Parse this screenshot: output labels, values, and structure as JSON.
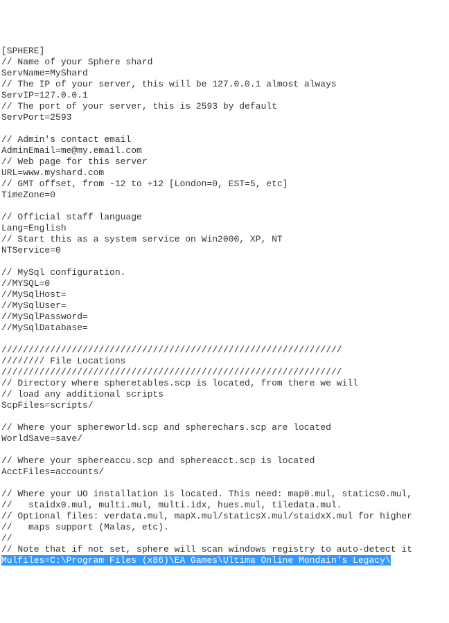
{
  "lines": [
    "[SPHERE]",
    "// Name of your Sphere shard",
    "ServName=MyShard",
    "// The IP of your server, this will be 127.0.0.1 almost always",
    "ServIP=127.0.0.1",
    "// The port of your server, this is 2593 by default",
    "ServPort=2593",
    "",
    "// Admin's contact email",
    "AdminEmail=me@my.email.com",
    "// Web page for this server",
    "URL=www.myshard.com",
    "// GMT offset, from -12 to +12 [London=0, EST=5, etc]",
    "TimeZone=0",
    "",
    "// Official staff language",
    "Lang=English",
    "// Start this as a system service on Win2000, XP, NT",
    "NTService=0",
    "",
    "// MySql configuration.",
    "//MYSQL=0",
    "//MySqlHost=",
    "//MySqlUser=",
    "//MySqlPassword=",
    "//MySqlDatabase=",
    "",
    "///////////////////////////////////////////////////////////////",
    "//////// File Locations",
    "///////////////////////////////////////////////////////////////",
    "// Directory where spheretables.scp is located, from there we will",
    "// load any additional scripts",
    "ScpFiles=scripts/",
    "",
    "// Where your sphereworld.scp and spherechars.scp are located",
    "WorldSave=save/",
    "",
    "// Where your sphereaccu.scp and sphereacct.scp is located",
    "AcctFiles=accounts/",
    "",
    "// Where your UO installation is located. This need: map0.mul, statics0.mul,",
    "//   staidx0.mul, multi.mul, multi.idx, hues.mul, tiledata.mul.",
    "// Optional files: verdata.mul, mapX.mul/staticsX.mul/staidxX.mul for higher",
    "//   maps support (Malas, etc).",
    "//",
    "// Note that if not set, sphere will scan windows registry to auto-detect it"
  ],
  "highlighted": "Mulfiles=C:\\Program Files (x86)\\EA Games\\Ultima Online Mondain's Legacy\\"
}
